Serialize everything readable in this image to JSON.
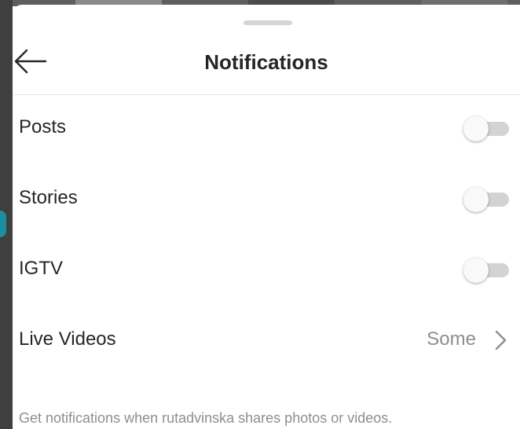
{
  "header": {
    "title": "Notifications",
    "back_icon": "arrow-left-icon"
  },
  "settings": [
    {
      "label": "Posts",
      "toggle_on": false
    },
    {
      "label": "Stories",
      "toggle_on": false
    },
    {
      "label": "IGTV",
      "toggle_on": false
    }
  ],
  "live_videos": {
    "label": "Live Videos",
    "value": "Some",
    "icon": "chevron-right-icon"
  },
  "footer": {
    "note": "Get notifications when rutadvinska shares photos or videos."
  },
  "colors": {
    "text_primary": "#262626",
    "text_secondary": "#8e8e8e",
    "toggle_track_off": "#d3d3d3",
    "divider": "#e6e6e6",
    "accent_dot": "#1b8fa0"
  }
}
